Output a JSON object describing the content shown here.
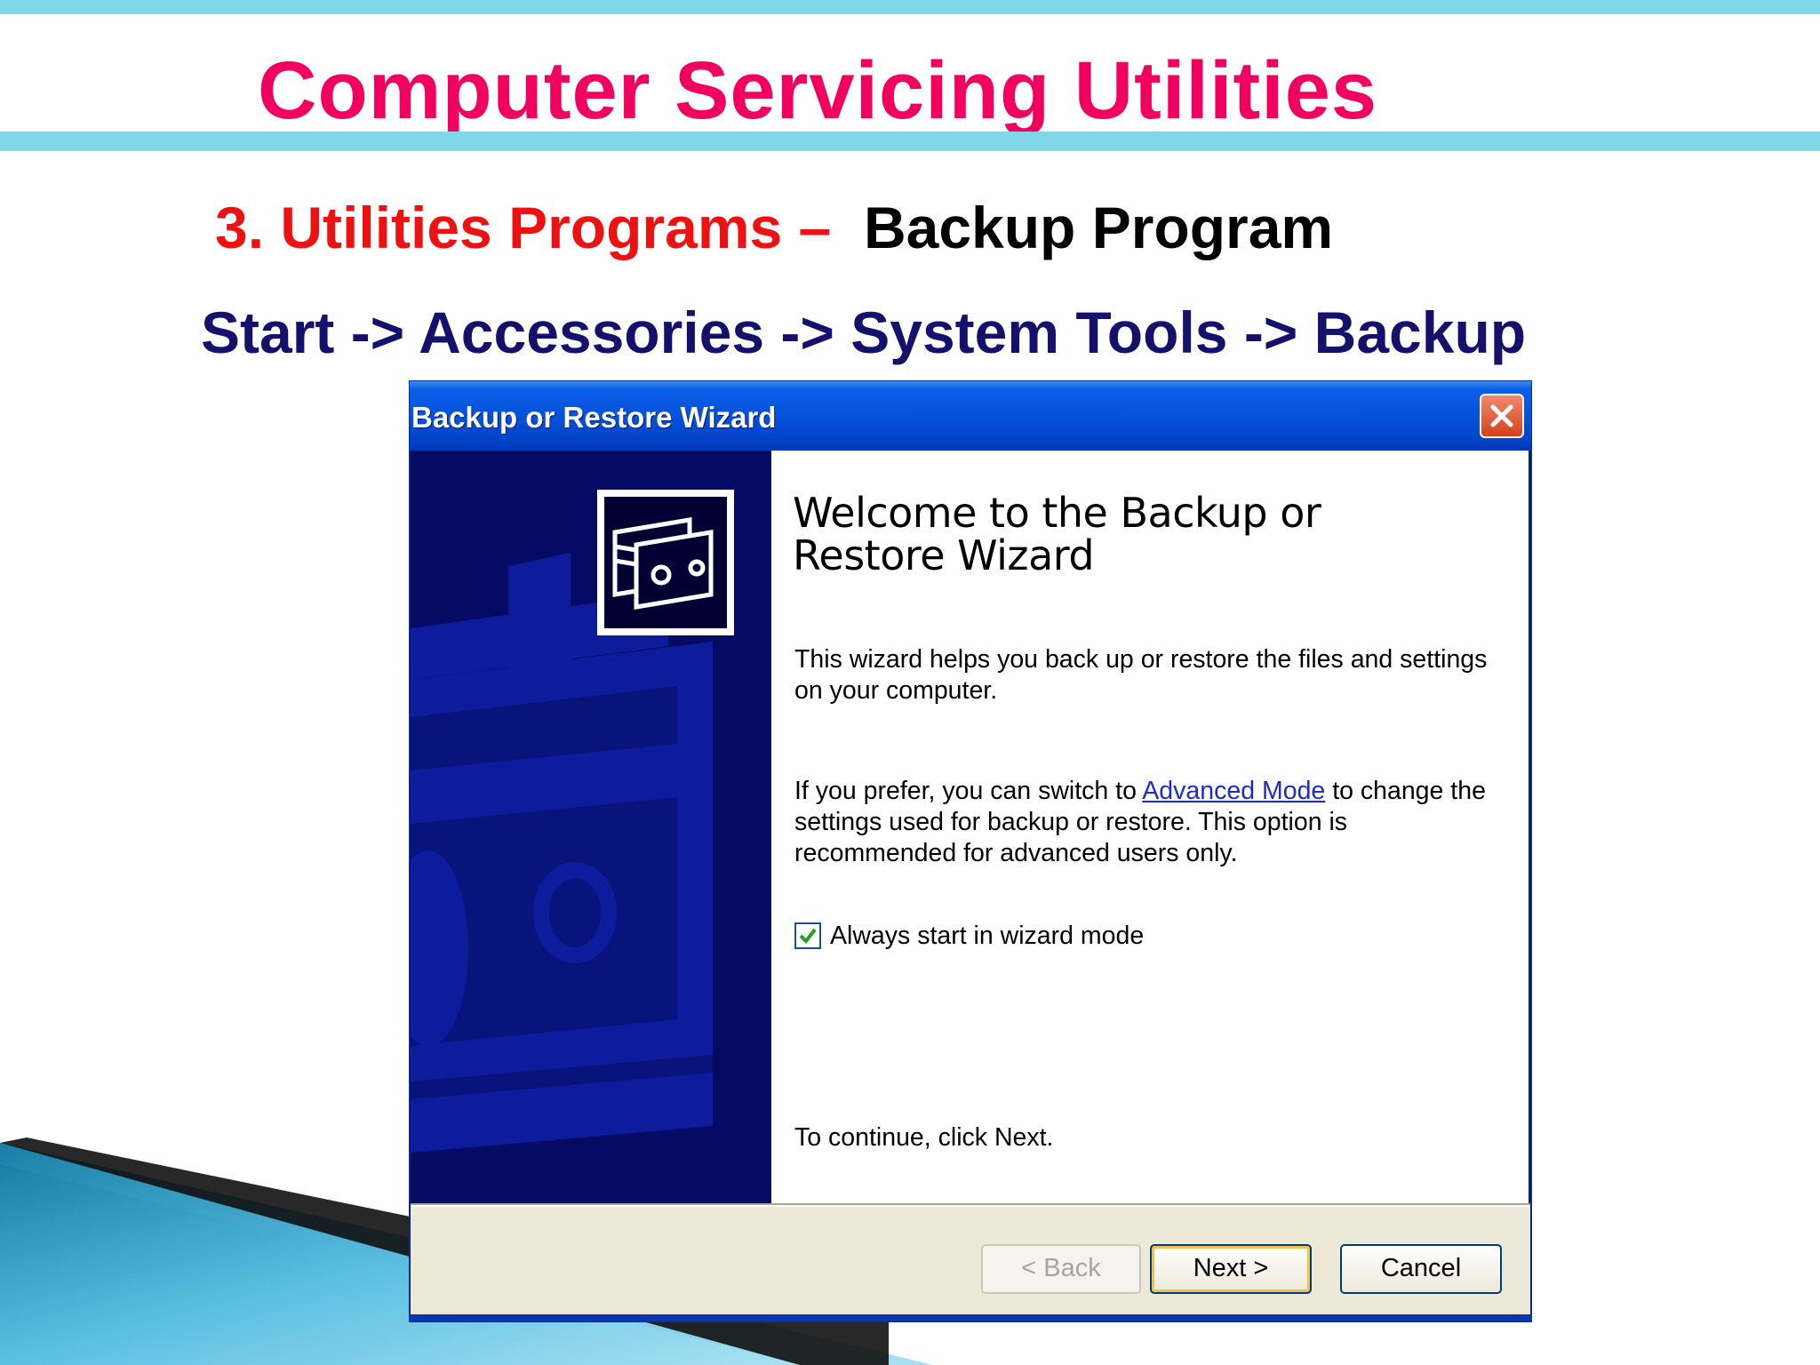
{
  "slide": {
    "title": "Computer Servicing Utilities",
    "subtitle_part1": "3. Utilities Programs –",
    "subtitle_part2": "Backup  Program",
    "path": "Start -> Accessories  -> System Tools  -> Backup"
  },
  "window": {
    "title": "Backup or Restore Wizard",
    "close_icon": "close-icon"
  },
  "content": {
    "welcome": "Welcome to the Backup or Restore Wizard",
    "para1": "This wizard helps you back up or restore the files and settings on your computer.",
    "para2_before": "If you prefer, you can switch to ",
    "para2_link": "Advanced Mode",
    "para2_after": " to change the settings used for backup or restore. This option is recommended for advanced users only.",
    "checkbox_label": "Always start in wizard mode",
    "checkbox_checked": true,
    "continue_text": "To continue, click Next."
  },
  "buttons": {
    "back": "< Back",
    "next": "Next >",
    "cancel": "Cancel"
  },
  "colors": {
    "title": "#f2005f",
    "subtitle_red": "#ee1111",
    "path_blue": "#14106b",
    "accent_bar": "#7fd7e8",
    "wizard_panel": "#050b62"
  }
}
